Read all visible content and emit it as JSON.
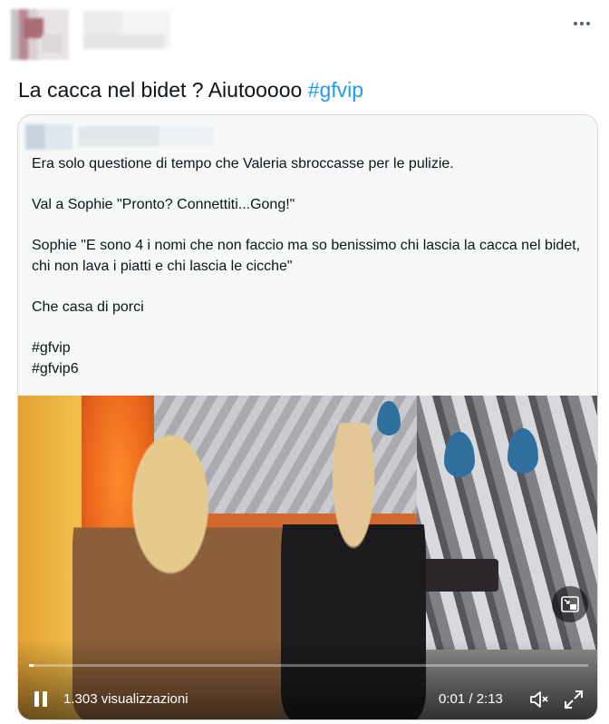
{
  "tweet": {
    "text": "La cacca nel bidet ? Aiutooooo ",
    "hashtag": "#gfvip",
    "more_icon": "more-dots-icon"
  },
  "quote": {
    "paragraphs": [
      "Era solo questione di tempo che Valeria sbroccasse per le pulizie.",
      "Val a Sophie \"Pronto? Connettiti...Gong!\"",
      "Sophie \"E sono 4 i nomi che non faccio ma so benissimo chi lascia la cacca nel bidet, chi non lava i piatti e chi lascia le cicche\"",
      "Che casa di porci"
    ],
    "tags": [
      "#gfvip",
      "#gfvip6"
    ]
  },
  "video": {
    "views": "1.303 visualizzazioni",
    "time": "0:01 / 2:13",
    "progress": 0.008,
    "pip_icon": "picture-in-picture-icon",
    "pause_icon": "pause-icon",
    "volume_icon": "volume-icon",
    "fullscreen_icon": "fullscreen-icon"
  },
  "colors": {
    "hashtag": "#1d9bf0",
    "card_border": "#cfd9de",
    "card_bg": "#f7f9f9"
  }
}
